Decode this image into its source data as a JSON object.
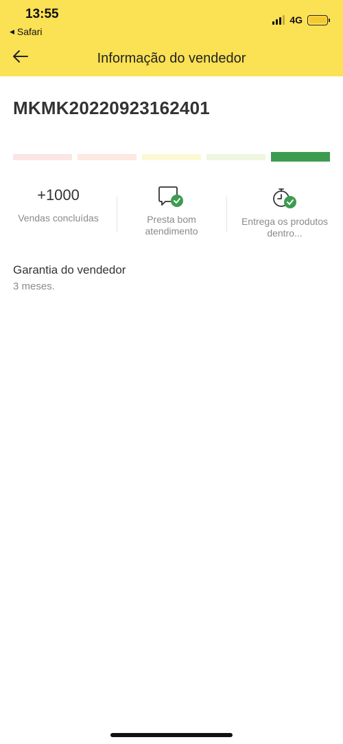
{
  "status_bar": {
    "time": "13:55",
    "back_app": "Safari",
    "network": "4G"
  },
  "header": {
    "title": "Informação do vendedor",
    "background": "#fbe154"
  },
  "seller": {
    "id": "MKMK20220923162401"
  },
  "reputation": {
    "segments": [
      {
        "color": "#fce6e4",
        "active": false
      },
      {
        "color": "#fde9e0",
        "active": false
      },
      {
        "color": "#fdf8d4",
        "active": false
      },
      {
        "color": "#eef6df",
        "active": false
      },
      {
        "color": "#3d9c4f",
        "active": true
      }
    ]
  },
  "metrics": {
    "sales": {
      "value": "+1000",
      "label": "Vendas concluídas"
    },
    "service": {
      "icon": "chat-check-icon",
      "label": "Presta bom atendimento"
    },
    "delivery": {
      "icon": "stopwatch-check-icon",
      "label": "Entrega os produtos dentro..."
    }
  },
  "warranty": {
    "title": "Garantia do vendedor",
    "text": "3 meses."
  }
}
